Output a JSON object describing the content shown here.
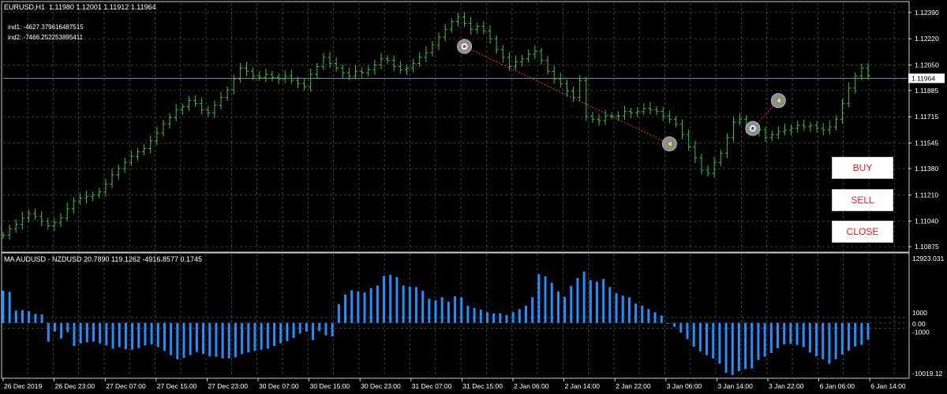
{
  "main_window": {
    "symbol_line": "EURUSD,H1  1.11980 1.12001 1.11912 1.11964",
    "ind1": "ind1: -4627.3796164875​15",
    "ind2": "ind2: -7466.252253895411",
    "price_ticks": [
      "1.12390",
      "1.12220",
      "1.12050",
      "1.11885",
      "1.11715",
      "1.11545",
      "1.11380",
      "1.11210",
      "1.11040",
      "1.10875"
    ],
    "current_price": "1.11964",
    "ylim": [
      1.1085,
      1.1245
    ]
  },
  "sub_window": {
    "label": "MA AUDUSD - NZDUSD 20.7890 119.1262 -4916.8577 0.1745",
    "ticks": {
      "top": "12923.031",
      "plus": "1000",
      "zero": "0.00",
      "minus": "-1000",
      "bottom": "-10019.12"
    },
    "ylim": [
      -10019.12,
      12923.031
    ]
  },
  "time_axis": [
    "26 Dec 2019",
    "26 Dec 23:00",
    "27 Dec 07:00",
    "27 Dec 15:00",
    "27 Dec 23:00",
    "30 Dec 07:00",
    "30 Dec 15:00",
    "30 Dec 23:00",
    "31 Dec 07:00",
    "31 Dec 15:00",
    "2 Jan 06:00",
    "2 Jan 14:00",
    "2 Jan 22:00",
    "3 Jan 06:00",
    "3 Jan 14:00",
    "3 Jan 22:00",
    "6 Jan 06:00",
    "6 Jan 14:00"
  ],
  "buttons": {
    "buy": "BUY",
    "sell": "SELL",
    "close": "CLOSE"
  },
  "colors": {
    "background": "#000000",
    "grid": "#4a4a4a",
    "bars": "#39c639",
    "histogram": "#1e90ff",
    "price_line": "#7a8fb0",
    "trade_line": "#ff3030",
    "button_text": "#e41e1e"
  },
  "chart_data": [
    {
      "type": "line",
      "title": "EURUSD,H1",
      "xlabel": "",
      "ylabel": "",
      "ylim": [
        1.1085,
        1.1245
      ],
      "series": [
        {
          "name": "EURUSD",
          "values": [
            1.1095,
            1.1099,
            1.1102,
            1.1106,
            1.1109,
            1.1107,
            1.1104,
            1.1101,
            1.1103,
            1.1106,
            1.1112,
            1.1117,
            1.1119,
            1.112,
            1.1121,
            1.1123,
            1.1128,
            1.1134,
            1.1138,
            1.1142,
            1.1146,
            1.1149,
            1.1151,
            1.1156,
            1.1161,
            1.1167,
            1.1171,
            1.1176,
            1.1178,
            1.1182,
            1.118,
            1.1176,
            1.1174,
            1.1179,
            1.1184,
            1.1189,
            1.1196,
            1.1203,
            1.1201,
            1.1198,
            1.1197,
            1.1199,
            1.1197,
            1.1196,
            1.1198,
            1.1195,
            1.1193,
            1.1191,
            1.1199,
            1.1204,
            1.121,
            1.1206,
            1.1203,
            1.12,
            1.1198,
            1.1201,
            1.12,
            1.1202,
            1.1205,
            1.1209,
            1.1208,
            1.1204,
            1.1202,
            1.1203,
            1.1206,
            1.121,
            1.1213,
            1.1218,
            1.1223,
            1.1228,
            1.1233,
            1.1236,
            1.1232,
            1.1228,
            1.123,
            1.1227,
            1.1222,
            1.1215,
            1.121,
            1.1204,
            1.1207,
            1.1209,
            1.1212,
            1.1214,
            1.1208,
            1.1201,
            1.1196,
            1.1193,
            1.1188,
            1.1184,
            1.1195,
            1.1172,
            1.117,
            1.1169,
            1.1172,
            1.1172,
            1.1172,
            1.1175,
            1.1174,
            1.1175,
            1.1177,
            1.1176,
            1.1175,
            1.1172,
            1.117,
            1.1167,
            1.116,
            1.1152,
            1.1145,
            1.1137,
            1.1135,
            1.1142,
            1.1148,
            1.1158,
            1.1168,
            1.117,
            1.1164,
            1.1162,
            1.1163,
            1.1158,
            1.116,
            1.1162,
            1.1163,
            1.1164,
            1.1166,
            1.1165,
            1.1166,
            1.1164,
            1.1163,
            1.1165,
            1.117,
            1.118,
            1.119,
            1.1198,
            1.1203,
            1.1198
          ]
        }
      ],
      "markers": [
        {
          "type": "entry",
          "index": 72,
          "value": 1.1217
        },
        {
          "type": "exit",
          "index": 104,
          "value": 1.1154
        },
        {
          "type": "entry",
          "index": 117,
          "value": 1.1164
        },
        {
          "type": "exit",
          "index": 121,
          "value": 1.1182
        }
      ]
    },
    {
      "type": "bar",
      "title": "MA AUDUSD - NZDUSD",
      "xlabel": "",
      "ylabel": "",
      "ylim": [
        -10019.12,
        12923.031
      ],
      "series": [
        {
          "name": "MA AUDUSD - NZDUSD",
          "values": [
            6000,
            5800,
            2300,
            2400,
            2200,
            1700,
            1600,
            -3500,
            -1600,
            -2900,
            -1700,
            -4300,
            -3800,
            -3600,
            -3500,
            -3800,
            -4200,
            -4800,
            -4500,
            -4900,
            -5000,
            -4700,
            -4200,
            -4000,
            -4500,
            -5200,
            -6000,
            -6800,
            -6500,
            -6000,
            -5400,
            -5800,
            -6200,
            -6300,
            -6600,
            -6600,
            -6400,
            -5800,
            -5500,
            -5200,
            -5000,
            -4800,
            -4300,
            -3800,
            -3400,
            -2800,
            -2000,
            -1600,
            -3200,
            -1500,
            -2300,
            -2500,
            3500,
            5300,
            6100,
            5900,
            5700,
            6500,
            7000,
            8800,
            9000,
            8600,
            7000,
            6800,
            6700,
            6000,
            4500,
            4200,
            4800,
            4000,
            5000,
            4800,
            3200,
            2800,
            2500,
            2000,
            1800,
            1800,
            1500,
            2000,
            2600,
            3200,
            4800,
            9100,
            8700,
            7500,
            5900,
            4900,
            6900,
            8400,
            9600,
            8000,
            7700,
            8200,
            6700,
            5600,
            5100,
            4800,
            3600,
            3200,
            2600,
            2000,
            1400,
            -100,
            -700,
            -1800,
            -3000,
            -4400,
            -5300,
            -6000,
            -6600,
            -7600,
            -9300,
            -9700,
            -9000,
            -8600,
            -8500,
            -6900,
            -6300,
            -5600,
            -4700,
            -4000,
            -3900,
            -4100,
            -4500,
            -5500,
            -6200,
            -6800,
            -7600,
            -6800,
            -5900,
            -5200,
            -4400,
            -4100,
            -3100
          ]
        }
      ]
    }
  ]
}
